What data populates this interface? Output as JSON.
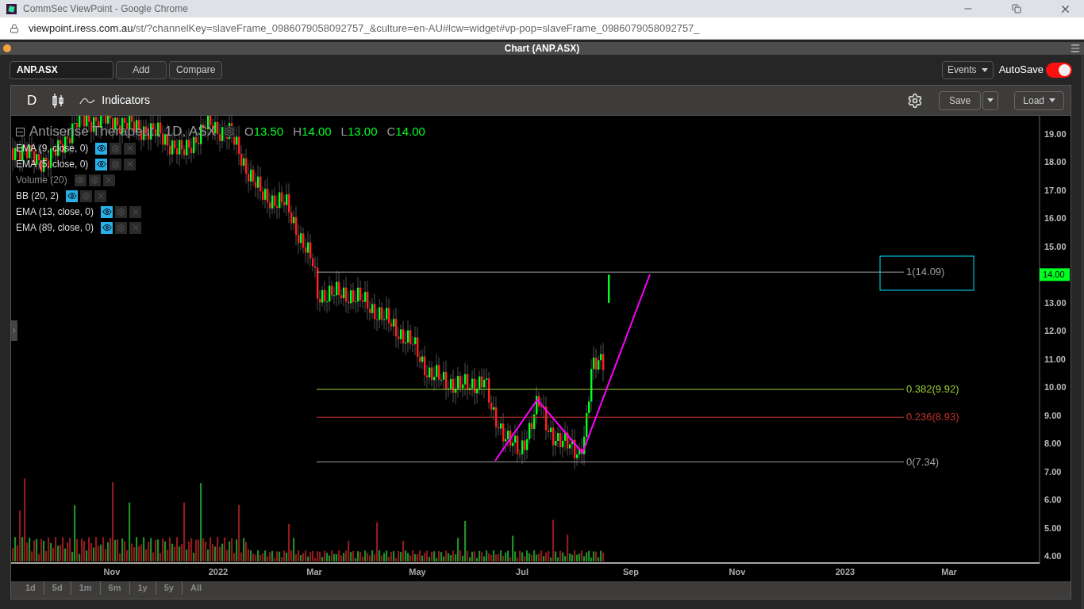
{
  "browser": {
    "title": "CommSec ViewPoint - Google Chrome",
    "url_host": "viewpoint.iress.com.au",
    "url_path": "/st/?channelKey=slaveFrame_0986079058092757_&culture=en-AU#lcw=widget#vp-pop=slaveFrame_0986079058092757_"
  },
  "window": {
    "title": "Chart (ANP.ASX)"
  },
  "toolbar": {
    "symbol": "ANP.ASX",
    "buttons": [
      "Add",
      "Compare"
    ],
    "events": "Events",
    "autosave": {
      "label": "AutoSave",
      "on": true
    }
  },
  "chart_toolbar": {
    "period": "D",
    "indicators": "Indicators",
    "save": "Save",
    "load": "Load"
  },
  "legend": {
    "title": "Antisense Therapeut., 1D, ASX",
    "ohlc": [
      {
        "key": "O",
        "value": "13.50"
      },
      {
        "key": "H",
        "value": "14.00"
      },
      {
        "key": "L",
        "value": "13.00"
      },
      {
        "key": "C",
        "value": "14.00"
      }
    ]
  },
  "indicators": [
    {
      "label": "EMA (9, close, 0)",
      "visible": true
    },
    {
      "label": "EMA (5, close, 0)",
      "visible": true
    },
    {
      "label": "Volume (20)",
      "visible": false
    },
    {
      "label": "BB (20, 2)",
      "visible": true
    },
    {
      "label": "EMA (13, close, 0)",
      "visible": true
    },
    {
      "label": "EMA (89, close, 0)",
      "visible": true
    }
  ],
  "fib_levels": [
    {
      "label": "1(14.09)",
      "color": "#a0a0a0"
    },
    {
      "label": "0.382(9.92)",
      "color": "#9acd32"
    },
    {
      "label": "0.236(8.93)",
      "color": "#c0302a"
    },
    {
      "label": "0(7.34)",
      "color": "#a0a0a0"
    }
  ],
  "price_axis": [
    "19.00",
    "18.00",
    "17.00",
    "16.00",
    "15.00",
    "13.00",
    "12.00",
    "11.00",
    "10.00",
    "9.00",
    "8.00",
    "7.00",
    "6.00",
    "5.00",
    "4.00"
  ],
  "current_price": "14.00",
  "date_axis": [
    "Nov",
    "2022",
    "Mar",
    "May",
    "Jul",
    "Sep",
    "Nov",
    "2023",
    "Mar"
  ],
  "ranges": [
    "1d",
    "5d",
    "1m",
    "6m",
    "1y",
    "5y",
    "All"
  ]
}
